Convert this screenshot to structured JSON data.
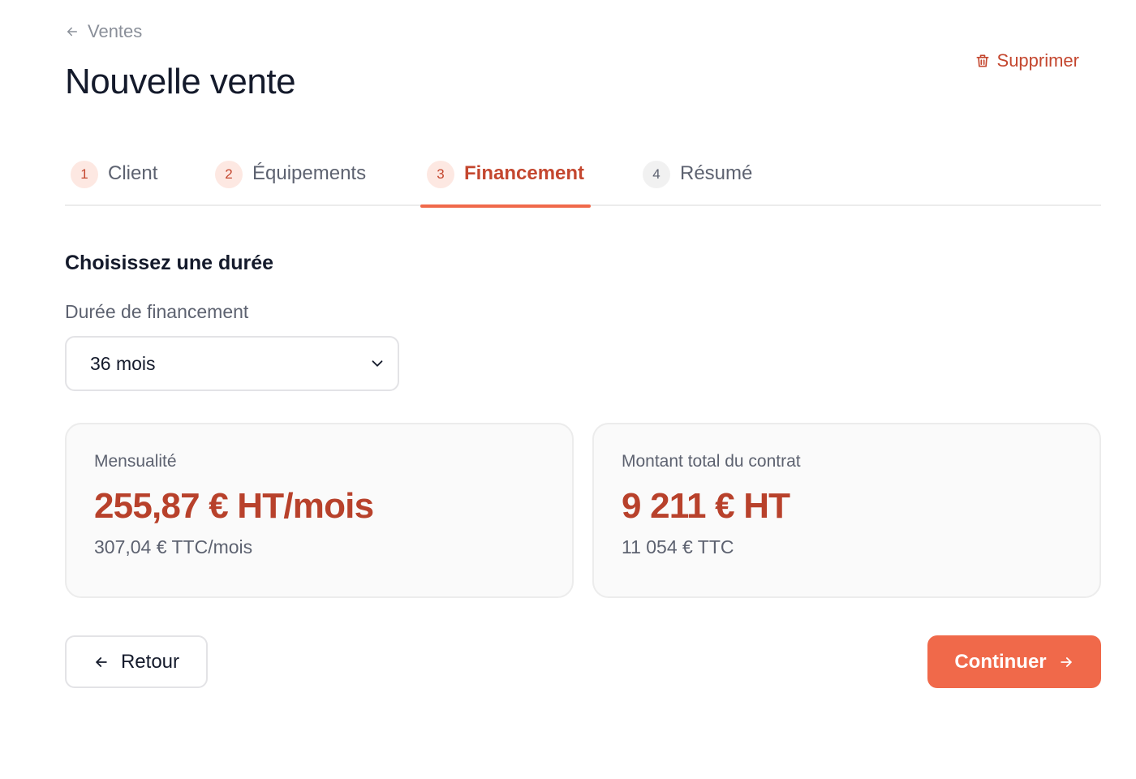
{
  "header": {
    "back_label": "Ventes",
    "title": "Nouvelle vente",
    "delete_label": "Supprimer"
  },
  "stepper": {
    "steps": [
      {
        "number": "1",
        "label": "Client",
        "state": "done"
      },
      {
        "number": "2",
        "label": "Équipements",
        "state": "done"
      },
      {
        "number": "3",
        "label": "Financement",
        "state": "active"
      },
      {
        "number": "4",
        "label": "Résumé",
        "state": "todo"
      }
    ]
  },
  "financing": {
    "section_title": "Choisissez une durée",
    "duration_label": "Durée de financement",
    "duration_value": "36 mois"
  },
  "summary": {
    "monthly": {
      "label": "Mensualité",
      "amount_ht": "255,87 € HT/mois",
      "amount_ttc": "307,04 € TTC/mois"
    },
    "total": {
      "label": "Montant total du contrat",
      "amount_ht": "9 211 € HT",
      "amount_ttc": "11 054 € TTC"
    }
  },
  "footer": {
    "back_label": "Retour",
    "continue_label": "Continuer"
  },
  "colors": {
    "accent": "#f0694a",
    "accent_text": "#c4472f",
    "amount": "#b8412b"
  },
  "icons": {
    "back": "arrow-left-icon",
    "delete": "trash-icon",
    "select": "chevron-down-icon",
    "continue": "arrow-right-icon"
  }
}
